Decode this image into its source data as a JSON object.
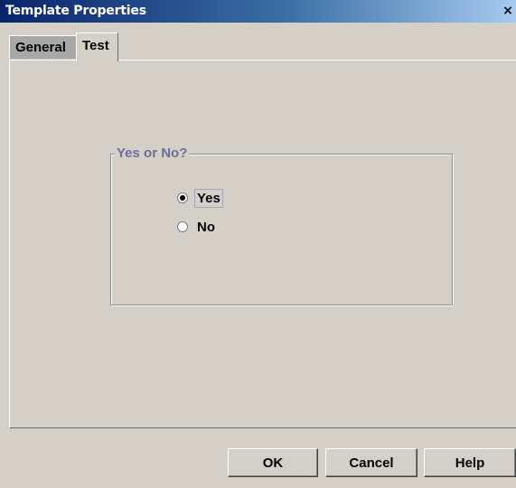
{
  "window": {
    "title": "Template Properties",
    "close_glyph": "×"
  },
  "tabs": [
    {
      "label": "General",
      "active": false
    },
    {
      "label": "Test",
      "active": true
    }
  ],
  "group": {
    "title": "Yes or No?",
    "options": [
      {
        "label": "Yes",
        "checked": true
      },
      {
        "label": "No",
        "checked": false
      }
    ]
  },
  "buttons": {
    "ok": "OK",
    "cancel": "Cancel",
    "help": "Help"
  },
  "colors": {
    "dialog_bg": "#d4d0c8",
    "titlebar_start": "#0a246a",
    "group_title": "#6a6e99",
    "inactive_tab": "#a8a8a8"
  }
}
